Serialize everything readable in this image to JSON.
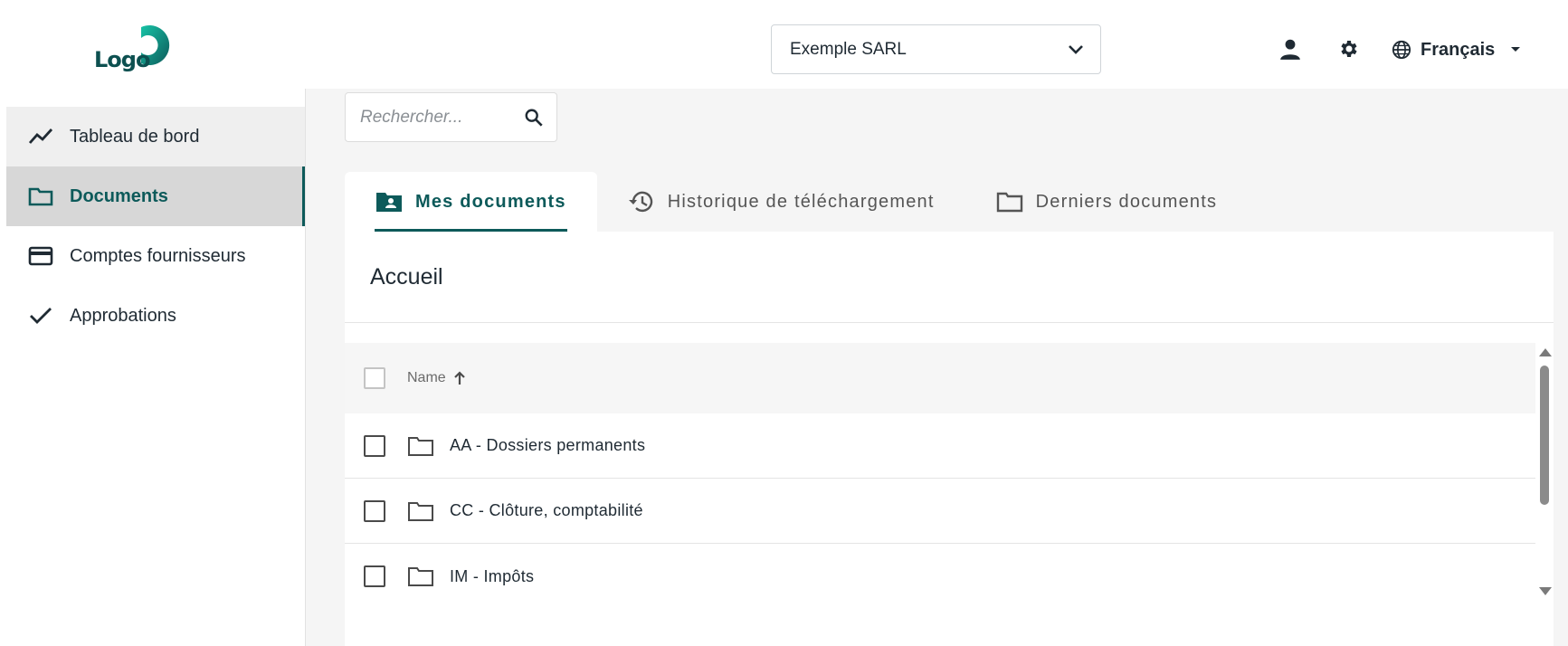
{
  "header": {
    "logo_text": "Logo",
    "company_select": {
      "value": "Exemple SARL",
      "icon": "chevron-down-icon"
    },
    "user_icon": "user-icon",
    "settings_icon": "gear-icon",
    "language": {
      "label": "Français",
      "icon": "globe-icon"
    }
  },
  "sidebar": {
    "items": [
      {
        "label": "Tableau de bord",
        "icon": "trending-line-icon"
      },
      {
        "label": "Documents",
        "icon": "folder-icon",
        "active": true
      },
      {
        "label": "Comptes fournisseurs",
        "icon": "credit-card-icon"
      },
      {
        "label": "Approbations",
        "icon": "checkmark-icon"
      }
    ]
  },
  "search": {
    "placeholder": "Rechercher..."
  },
  "tabs": [
    {
      "label": "Mes documents",
      "icon": "folder-shared-icon",
      "active": true
    },
    {
      "label": "Historique de téléchargement",
      "icon": "history-icon"
    },
    {
      "label": "Derniers documents",
      "icon": "folder-icon"
    }
  ],
  "main": {
    "breadcrumb": "Accueil",
    "table": {
      "column_name": "Name",
      "sort": "ascending",
      "rows": [
        {
          "label": "AA - Dossiers permanents"
        },
        {
          "label": "CC - Clôture, comptabilité"
        },
        {
          "label": "IM - Impôts"
        }
      ]
    }
  },
  "colors": {
    "accent": "#0d5a5a",
    "logo_gradient_start": "#17c3a6",
    "logo_gradient_end": "#0d5a5a"
  }
}
